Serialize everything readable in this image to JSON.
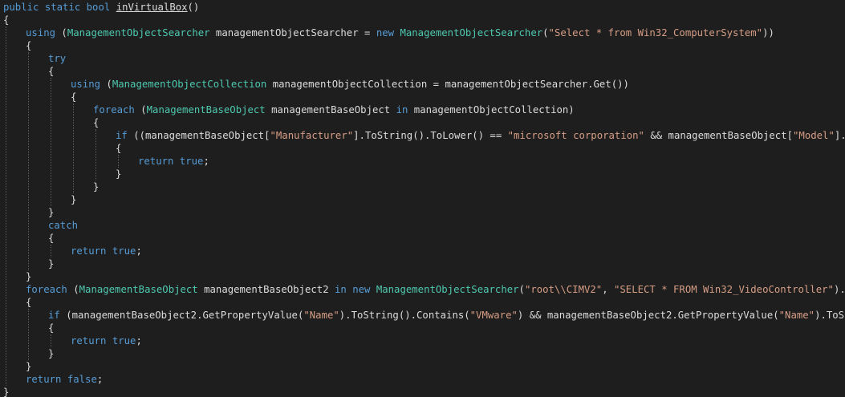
{
  "editor": {
    "language": "C#",
    "colors": {
      "background": "#1e1e1e",
      "keyword": "#569cd6",
      "type": "#4ec9b0",
      "string": "#d69d85",
      "identifier": "#dcdcdc"
    },
    "lines": [
      {
        "indent": 0,
        "tokens": [
          [
            "kw",
            "public"
          ],
          [
            "id",
            " "
          ],
          [
            "kw",
            "static"
          ],
          [
            "id",
            " "
          ],
          [
            "kw",
            "bool"
          ],
          [
            "id",
            " "
          ],
          [
            "fn",
            "inVirtualBox"
          ],
          [
            "id",
            "()"
          ]
        ]
      },
      {
        "indent": 0,
        "tokens": [
          [
            "id",
            "{"
          ]
        ]
      },
      {
        "indent": 1,
        "tokens": [
          [
            "kw",
            "using"
          ],
          [
            "id",
            " ("
          ],
          [
            "ty",
            "ManagementObjectSearcher"
          ],
          [
            "id",
            " managementObjectSearcher = "
          ],
          [
            "kw",
            "new"
          ],
          [
            "id",
            " "
          ],
          [
            "ty",
            "ManagementObjectSearcher"
          ],
          [
            "id",
            "("
          ],
          [
            "str",
            "\"Select * from Win32_ComputerSystem\""
          ],
          [
            "id",
            "))"
          ]
        ]
      },
      {
        "indent": 1,
        "tokens": [
          [
            "id",
            "{"
          ]
        ]
      },
      {
        "indent": 2,
        "tokens": [
          [
            "kw",
            "try"
          ]
        ]
      },
      {
        "indent": 2,
        "tokens": [
          [
            "id",
            "{"
          ]
        ]
      },
      {
        "indent": 3,
        "tokens": [
          [
            "kw",
            "using"
          ],
          [
            "id",
            " ("
          ],
          [
            "ty",
            "ManagementObjectCollection"
          ],
          [
            "id",
            " managementObjectCollection = managementObjectSearcher.Get())"
          ]
        ]
      },
      {
        "indent": 3,
        "tokens": [
          [
            "id",
            "{"
          ]
        ]
      },
      {
        "indent": 4,
        "tokens": [
          [
            "kw",
            "foreach"
          ],
          [
            "id",
            " ("
          ],
          [
            "ty",
            "ManagementBaseObject"
          ],
          [
            "id",
            " managementBaseObject "
          ],
          [
            "kw",
            "in"
          ],
          [
            "id",
            " managementObjectCollection)"
          ]
        ]
      },
      {
        "indent": 4,
        "tokens": [
          [
            "id",
            "{"
          ]
        ]
      },
      {
        "indent": 5,
        "tokens": [
          [
            "kw",
            "if"
          ],
          [
            "id",
            " ((managementBaseObject["
          ],
          [
            "str",
            "\"Manufacturer\""
          ],
          [
            "id",
            "].ToString().ToLower() == "
          ],
          [
            "str",
            "\"microsoft corporation\""
          ],
          [
            "id",
            " && managementBaseObject["
          ],
          [
            "str",
            "\"Model\""
          ],
          [
            "id",
            "].ToString"
          ]
        ]
      },
      {
        "indent": 5,
        "tokens": [
          [
            "id",
            "{"
          ]
        ]
      },
      {
        "indent": 6,
        "tokens": [
          [
            "kw",
            "return"
          ],
          [
            "id",
            " "
          ],
          [
            "kw",
            "true"
          ],
          [
            "id",
            ";"
          ]
        ]
      },
      {
        "indent": 5,
        "tokens": [
          [
            "id",
            "}"
          ]
        ]
      },
      {
        "indent": 4,
        "tokens": [
          [
            "id",
            "}"
          ]
        ]
      },
      {
        "indent": 3,
        "tokens": [
          [
            "id",
            "}"
          ]
        ]
      },
      {
        "indent": 2,
        "tokens": [
          [
            "id",
            "}"
          ]
        ]
      },
      {
        "indent": 2,
        "tokens": [
          [
            "kw",
            "catch"
          ]
        ]
      },
      {
        "indent": 2,
        "tokens": [
          [
            "id",
            "{"
          ]
        ]
      },
      {
        "indent": 3,
        "tokens": [
          [
            "kw",
            "return"
          ],
          [
            "id",
            " "
          ],
          [
            "kw",
            "true"
          ],
          [
            "id",
            ";"
          ]
        ]
      },
      {
        "indent": 2,
        "tokens": [
          [
            "id",
            "}"
          ]
        ]
      },
      {
        "indent": 1,
        "tokens": [
          [
            "id",
            "}"
          ]
        ]
      },
      {
        "indent": 1,
        "tokens": [
          [
            "kw",
            "foreach"
          ],
          [
            "id",
            " ("
          ],
          [
            "ty",
            "ManagementBaseObject"
          ],
          [
            "id",
            " managementBaseObject2 "
          ],
          [
            "kw",
            "in"
          ],
          [
            "id",
            " "
          ],
          [
            "kw",
            "new"
          ],
          [
            "id",
            " "
          ],
          [
            "ty",
            "ManagementObjectSearcher"
          ],
          [
            "id",
            "("
          ],
          [
            "str",
            "\"root\\\\CIMV2\""
          ],
          [
            "id",
            ", "
          ],
          [
            "str",
            "\"SELECT * FROM Win32_VideoController\""
          ],
          [
            "id",
            ").Get())"
          ]
        ]
      },
      {
        "indent": 1,
        "tokens": [
          [
            "id",
            "{"
          ]
        ]
      },
      {
        "indent": 2,
        "tokens": [
          [
            "kw",
            "if"
          ],
          [
            "id",
            " (managementBaseObject2.GetPropertyValue("
          ],
          [
            "str",
            "\"Name\""
          ],
          [
            "id",
            ").ToString().Contains("
          ],
          [
            "str",
            "\"VMware\""
          ],
          [
            "id",
            ") && managementBaseObject2.GetPropertyValue("
          ],
          [
            "str",
            "\"Name\""
          ],
          [
            "id",
            ").ToString()."
          ]
        ]
      },
      {
        "indent": 2,
        "tokens": [
          [
            "id",
            "{"
          ]
        ]
      },
      {
        "indent": 3,
        "tokens": [
          [
            "kw",
            "return"
          ],
          [
            "id",
            " "
          ],
          [
            "kw",
            "true"
          ],
          [
            "id",
            ";"
          ]
        ]
      },
      {
        "indent": 2,
        "tokens": [
          [
            "id",
            "}"
          ]
        ]
      },
      {
        "indent": 1,
        "tokens": [
          [
            "id",
            "}"
          ]
        ]
      },
      {
        "indent": 1,
        "tokens": [
          [
            "kw",
            "return"
          ],
          [
            "id",
            " "
          ],
          [
            "kw",
            "false"
          ],
          [
            "id",
            ";"
          ]
        ]
      },
      {
        "indent": 0,
        "tokens": [
          [
            "id",
            "}"
          ]
        ]
      }
    ]
  }
}
